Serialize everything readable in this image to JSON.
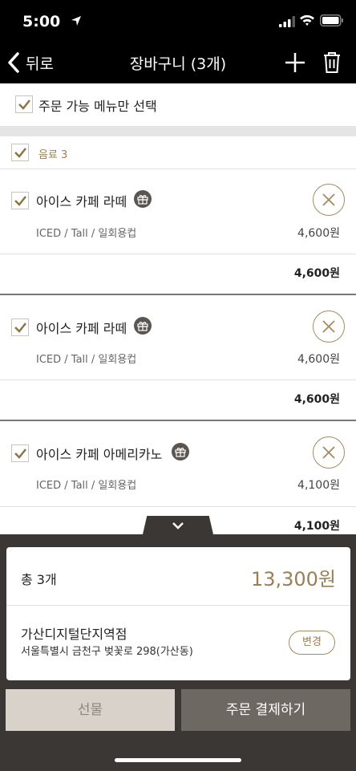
{
  "status_bar": {
    "time": "5:00"
  },
  "nav": {
    "back_label": "뒤로",
    "title": "장바구니 (3개)"
  },
  "select_only": {
    "label": "주문 가능 메뉴만 선택",
    "checked": true
  },
  "category": {
    "label": "음료 3",
    "checked": true
  },
  "items": [
    {
      "name": "아이스 카페 라떼",
      "options": "ICED / Tall / 일회용컵",
      "price": "4,600원",
      "total": "4,600원",
      "checked": true
    },
    {
      "name": "아이스 카페 라떼",
      "options": "ICED / Tall / 일회용컵",
      "price": "4,600원",
      "total": "4,600원",
      "checked": true
    },
    {
      "name": "아이스 카페 아메리카노",
      "options": "ICED / Tall / 일회용컵",
      "price": "4,100원",
      "total": "4,100원",
      "checked": true
    }
  ],
  "summary": {
    "count_label": "총 3개",
    "total_amount": "13,300원",
    "store_name": "가산디지털단지역점",
    "store_address": "서울특별시 금천구 벚꽃로 298(가산동)",
    "change_label": "변경"
  },
  "actions": {
    "gift_label": "선물",
    "pay_label": "주문 결제하기"
  },
  "colors": {
    "accent": "#9a7f55",
    "header_bg": "#000000",
    "panel_bg": "#3a3734",
    "pay_button": "#6e6863",
    "gift_button": "#d9d2ca"
  }
}
